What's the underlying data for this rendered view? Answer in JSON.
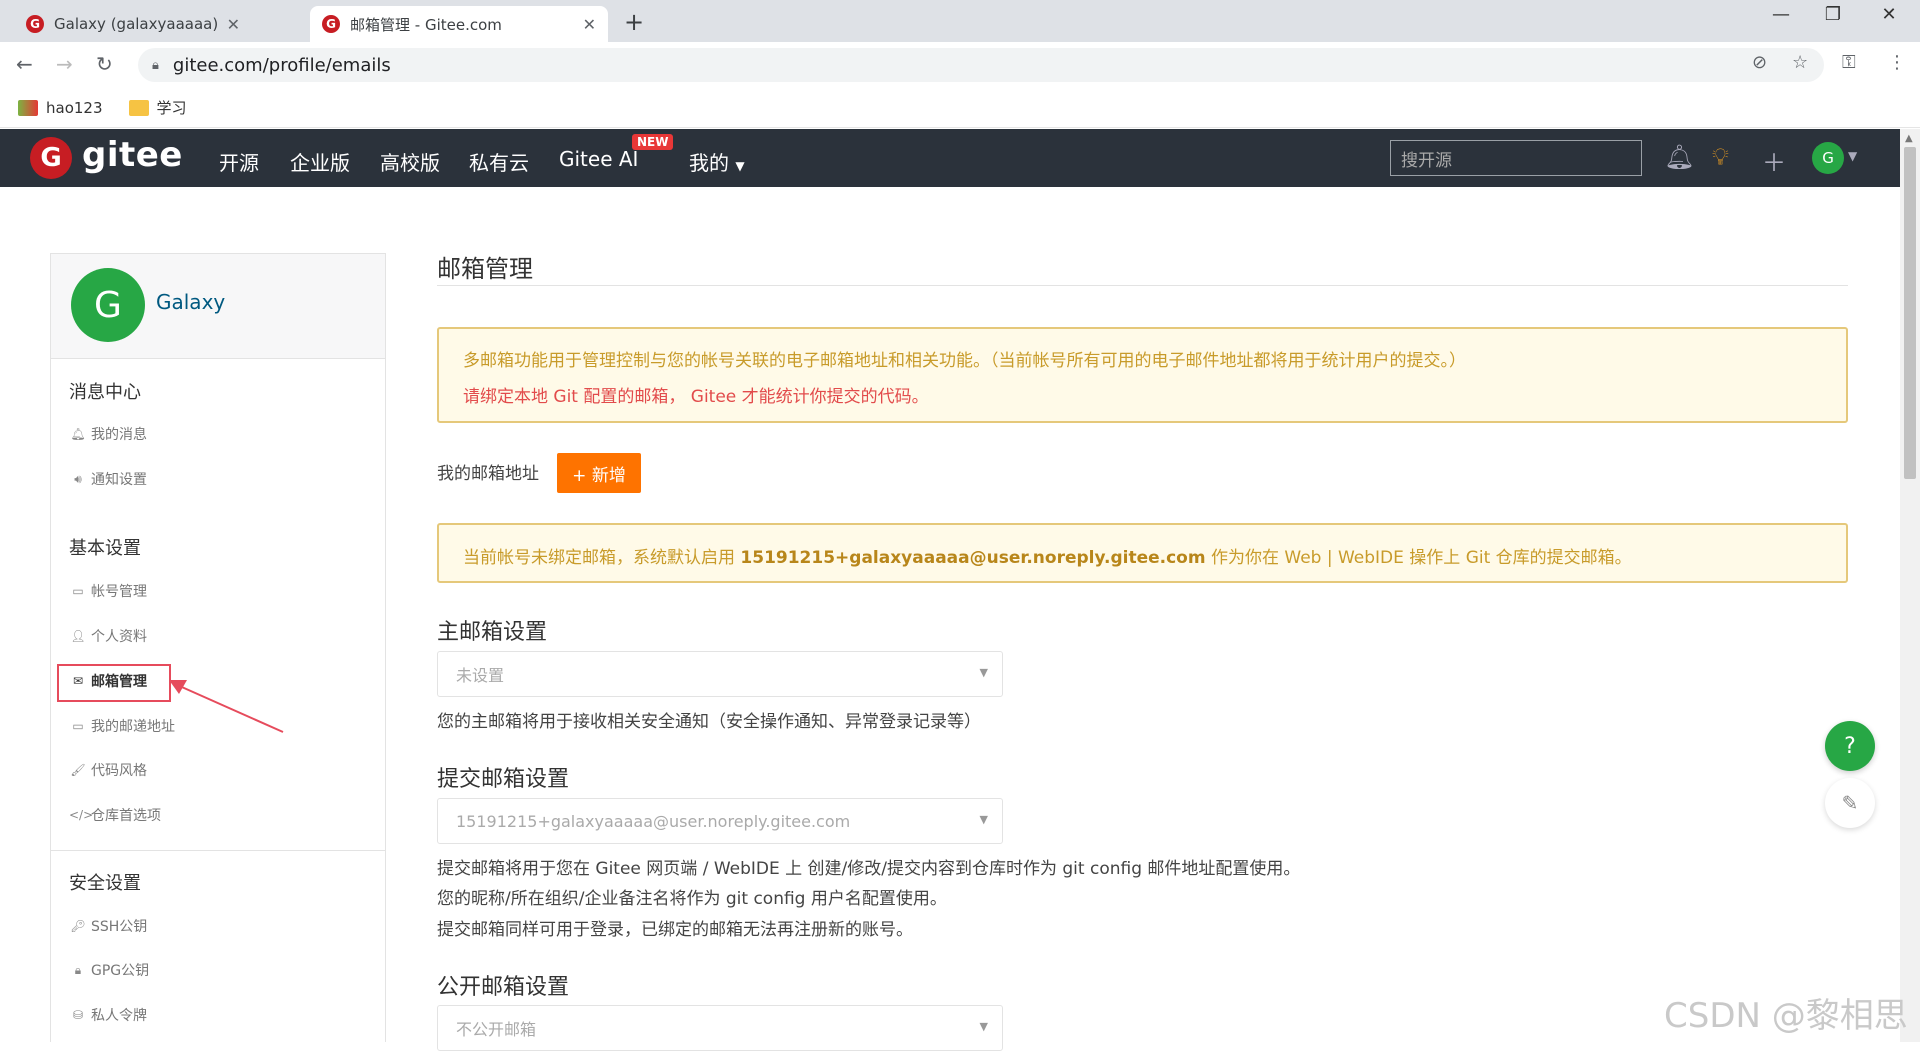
{
  "browser": {
    "tabs": [
      {
        "title": "Galaxy (galaxyaaaaa) - Gitee.co",
        "favicon": "G",
        "active": false
      },
      {
        "title": "邮箱管理 - Gitee.com",
        "favicon": "G",
        "active": true
      }
    ],
    "url": "gitee.com/profile/emails",
    "bookmarks": [
      {
        "label": "hao123",
        "icon": "hao123-icon"
      },
      {
        "label": "学习",
        "icon": "folder-icon"
      }
    ]
  },
  "header": {
    "logo_text": "gitee",
    "nav": [
      "开源",
      "企业版",
      "高校版",
      "私有云",
      "Gitee AI",
      "我的"
    ],
    "new_badge": "NEW",
    "search_placeholder": "搜开源",
    "avatar_letter": "G"
  },
  "sidebar": {
    "avatar_letter": "G",
    "username": "Galaxy",
    "groups": [
      {
        "title": "消息中心",
        "items": [
          {
            "label": "我的消息",
            "icon": "bell-icon"
          },
          {
            "label": "通知设置",
            "icon": "speaker-icon"
          }
        ]
      },
      {
        "title": "基本设置",
        "items": [
          {
            "label": "帐号管理",
            "icon": "id-card-icon"
          },
          {
            "label": "个人资料",
            "icon": "user-icon"
          },
          {
            "label": "邮箱管理",
            "icon": "envelope-icon",
            "active": true
          },
          {
            "label": "我的邮递地址",
            "icon": "address-card-icon"
          },
          {
            "label": "代码风格",
            "icon": "brush-icon"
          },
          {
            "label": "仓库首选项",
            "icon": "code-icon"
          }
        ]
      },
      {
        "title": "安全设置",
        "items": [
          {
            "label": "SSH公钥",
            "icon": "key-icon"
          },
          {
            "label": "GPG公钥",
            "icon": "lock-icon"
          },
          {
            "label": "私人令牌",
            "icon": "token-icon"
          }
        ]
      }
    ]
  },
  "main": {
    "title": "邮箱管理",
    "notice1_line1": "多邮箱功能用于管理控制与您的帐号关联的电子邮箱地址和相关功能。（当前帐号所有可用的电子邮件地址都将用于统计用户的提交。）",
    "notice1_line2": "请绑定本地 Git 配置的邮箱， Gitee 才能统计你提交的代码。",
    "my_emails_label": "我的邮箱地址",
    "add_button": "+ 新增",
    "notice2_prefix": "当前帐号未绑定邮箱，系统默认启用 ",
    "notice2_email": "15191215+galaxyaaaaa@user.noreply.gitee.com",
    "notice2_suffix": " 作为你在 Web | WebIDE 操作上 Git 仓库的提交邮箱。",
    "primary": {
      "title": "主邮箱设置",
      "value": "未设置",
      "hint": "您的主邮箱将用于接收相关安全通知（安全操作通知、异常登录记录等）"
    },
    "commit": {
      "title": "提交邮箱设置",
      "value": "15191215+galaxyaaaaa@user.noreply.gitee.com",
      "hints": [
        "提交邮箱将用于您在 Gitee 网页端 / WebIDE 上 创建/修改/提交内容到仓库时作为 git config 邮件地址配置使用。",
        "您的昵称/所在组织/企业备注名将作为 git config 用户名配置使用。",
        "提交邮箱同样可用于登录，已绑定的邮箱无法再注册新的账号。"
      ]
    },
    "public": {
      "title": "公开邮箱设置",
      "value": "不公开邮箱"
    }
  },
  "float": {
    "help": "?"
  },
  "watermark": "CSDN @黎相思",
  "colors": {
    "brand_red": "#c71d23",
    "header_bg": "#2b323b",
    "green": "#27a745",
    "orange": "#fe7300",
    "annotation": "#e64b5c"
  }
}
